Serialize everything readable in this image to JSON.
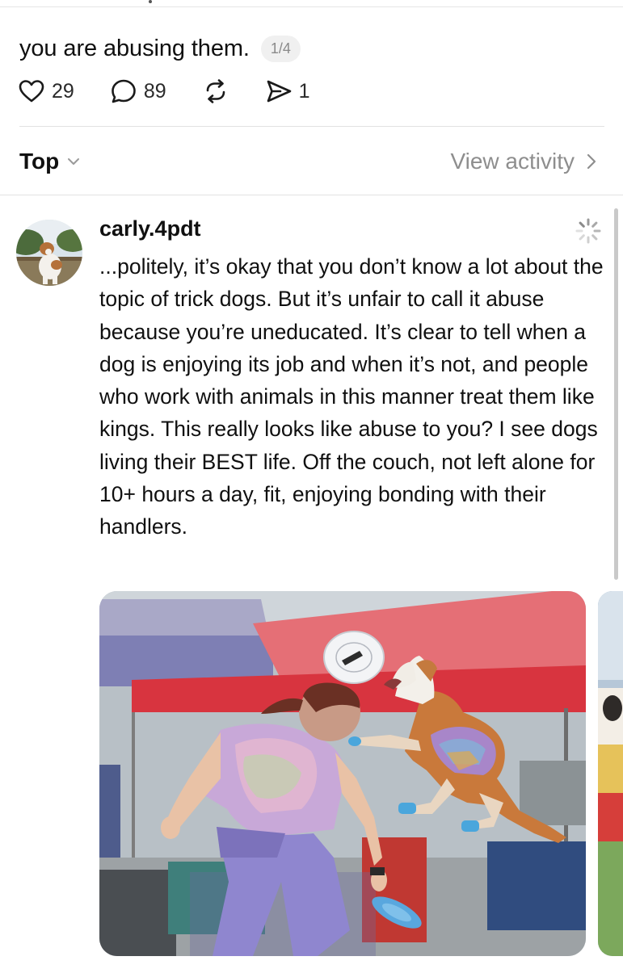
{
  "post": {
    "caption": "you are abusing them.",
    "page_indicator": "1/4",
    "actions": {
      "like_icon": "heart-icon",
      "likes": "29",
      "reply_icon": "comment-bubble-icon",
      "replies": "89",
      "repost_icon": "repost-icon",
      "share_icon": "send-icon",
      "shares": "1"
    }
  },
  "sort": {
    "label": "Top",
    "icon": "chevron-down-icon",
    "view_activity": "View activity",
    "view_activity_icon": "chevron-right-icon"
  },
  "reply": {
    "username": "carly.4pdt",
    "status_icon": "loading-spinner-icon",
    "text": "...politely, it’s okay that you don’t know a lot about the topic of trick dogs. But it’s unfair to call it abuse because you’re uneducated. It’s clear to tell when a dog is enjoying its job and when it’s not, and people who work with animals in this manner treat them like kings. This really looks like abuse to you? I see dogs living their BEST life. Off the couch, not left alone for 10+ hours a day, fit, enjoying bonding with their handlers."
  },
  "colors": {
    "text": "#101010",
    "muted": "#8e8e8e",
    "divider": "#e2e2e2",
    "canopy_red": "#e0434e",
    "canopy_purple": "#7e7fb4"
  }
}
